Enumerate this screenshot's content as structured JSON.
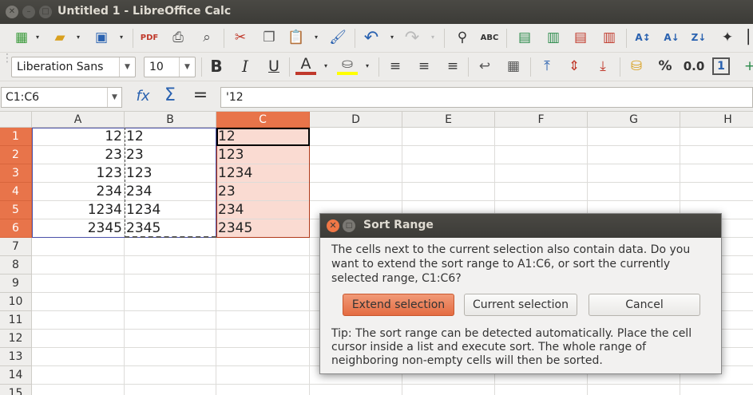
{
  "window": {
    "title": "Untitled 1 - LibreOffice Calc"
  },
  "toolbar_format": {
    "font_name": "Liberation Sans",
    "font_size": "10",
    "bold": "B",
    "italic": "I",
    "underline": "U",
    "font_color": "A",
    "percent": "%",
    "decimal": "0.0",
    "calendar": "1"
  },
  "formula_bar": {
    "name_box": "C1:C6",
    "fx": "fx",
    "sum": "Σ",
    "equals": "=",
    "content": "'12"
  },
  "sheet": {
    "columns": [
      "A",
      "B",
      "C",
      "D",
      "E",
      "F",
      "G",
      "H"
    ],
    "selected_column": "C",
    "rows": [
      "1",
      "2",
      "3",
      "4",
      "5",
      "6",
      "7",
      "8",
      "9",
      "10",
      "11",
      "12",
      "13",
      "14",
      "15"
    ],
    "selected_rows": [
      "1",
      "2",
      "3",
      "4",
      "5",
      "6"
    ],
    "colA": [
      "12",
      "23",
      "123",
      "234",
      "1234",
      "2345"
    ],
    "colB": [
      "12",
      "23",
      "123",
      "234",
      "1234",
      "2345"
    ],
    "colC": [
      "12",
      "123",
      "1234",
      "23",
      "234",
      "2345"
    ]
  },
  "dialog": {
    "title": "Sort Range",
    "message": "The cells next to the current selection also contain data. Do you want to extend the sort range to A1:C6, or sort the currently selected range, C1:C6?",
    "extend_label": "Extend selection",
    "current_label": "Current selection",
    "cancel_label": "Cancel",
    "tip": "Tip: The sort range can be detected automatically. Place the cell cursor inside a list and execute sort. The whole range of neighboring non-empty cells will then be sorted."
  },
  "colors": {
    "selection_header": "#e8744a",
    "selection_fill": "#fadbd2",
    "default_button": "#e46c42"
  }
}
